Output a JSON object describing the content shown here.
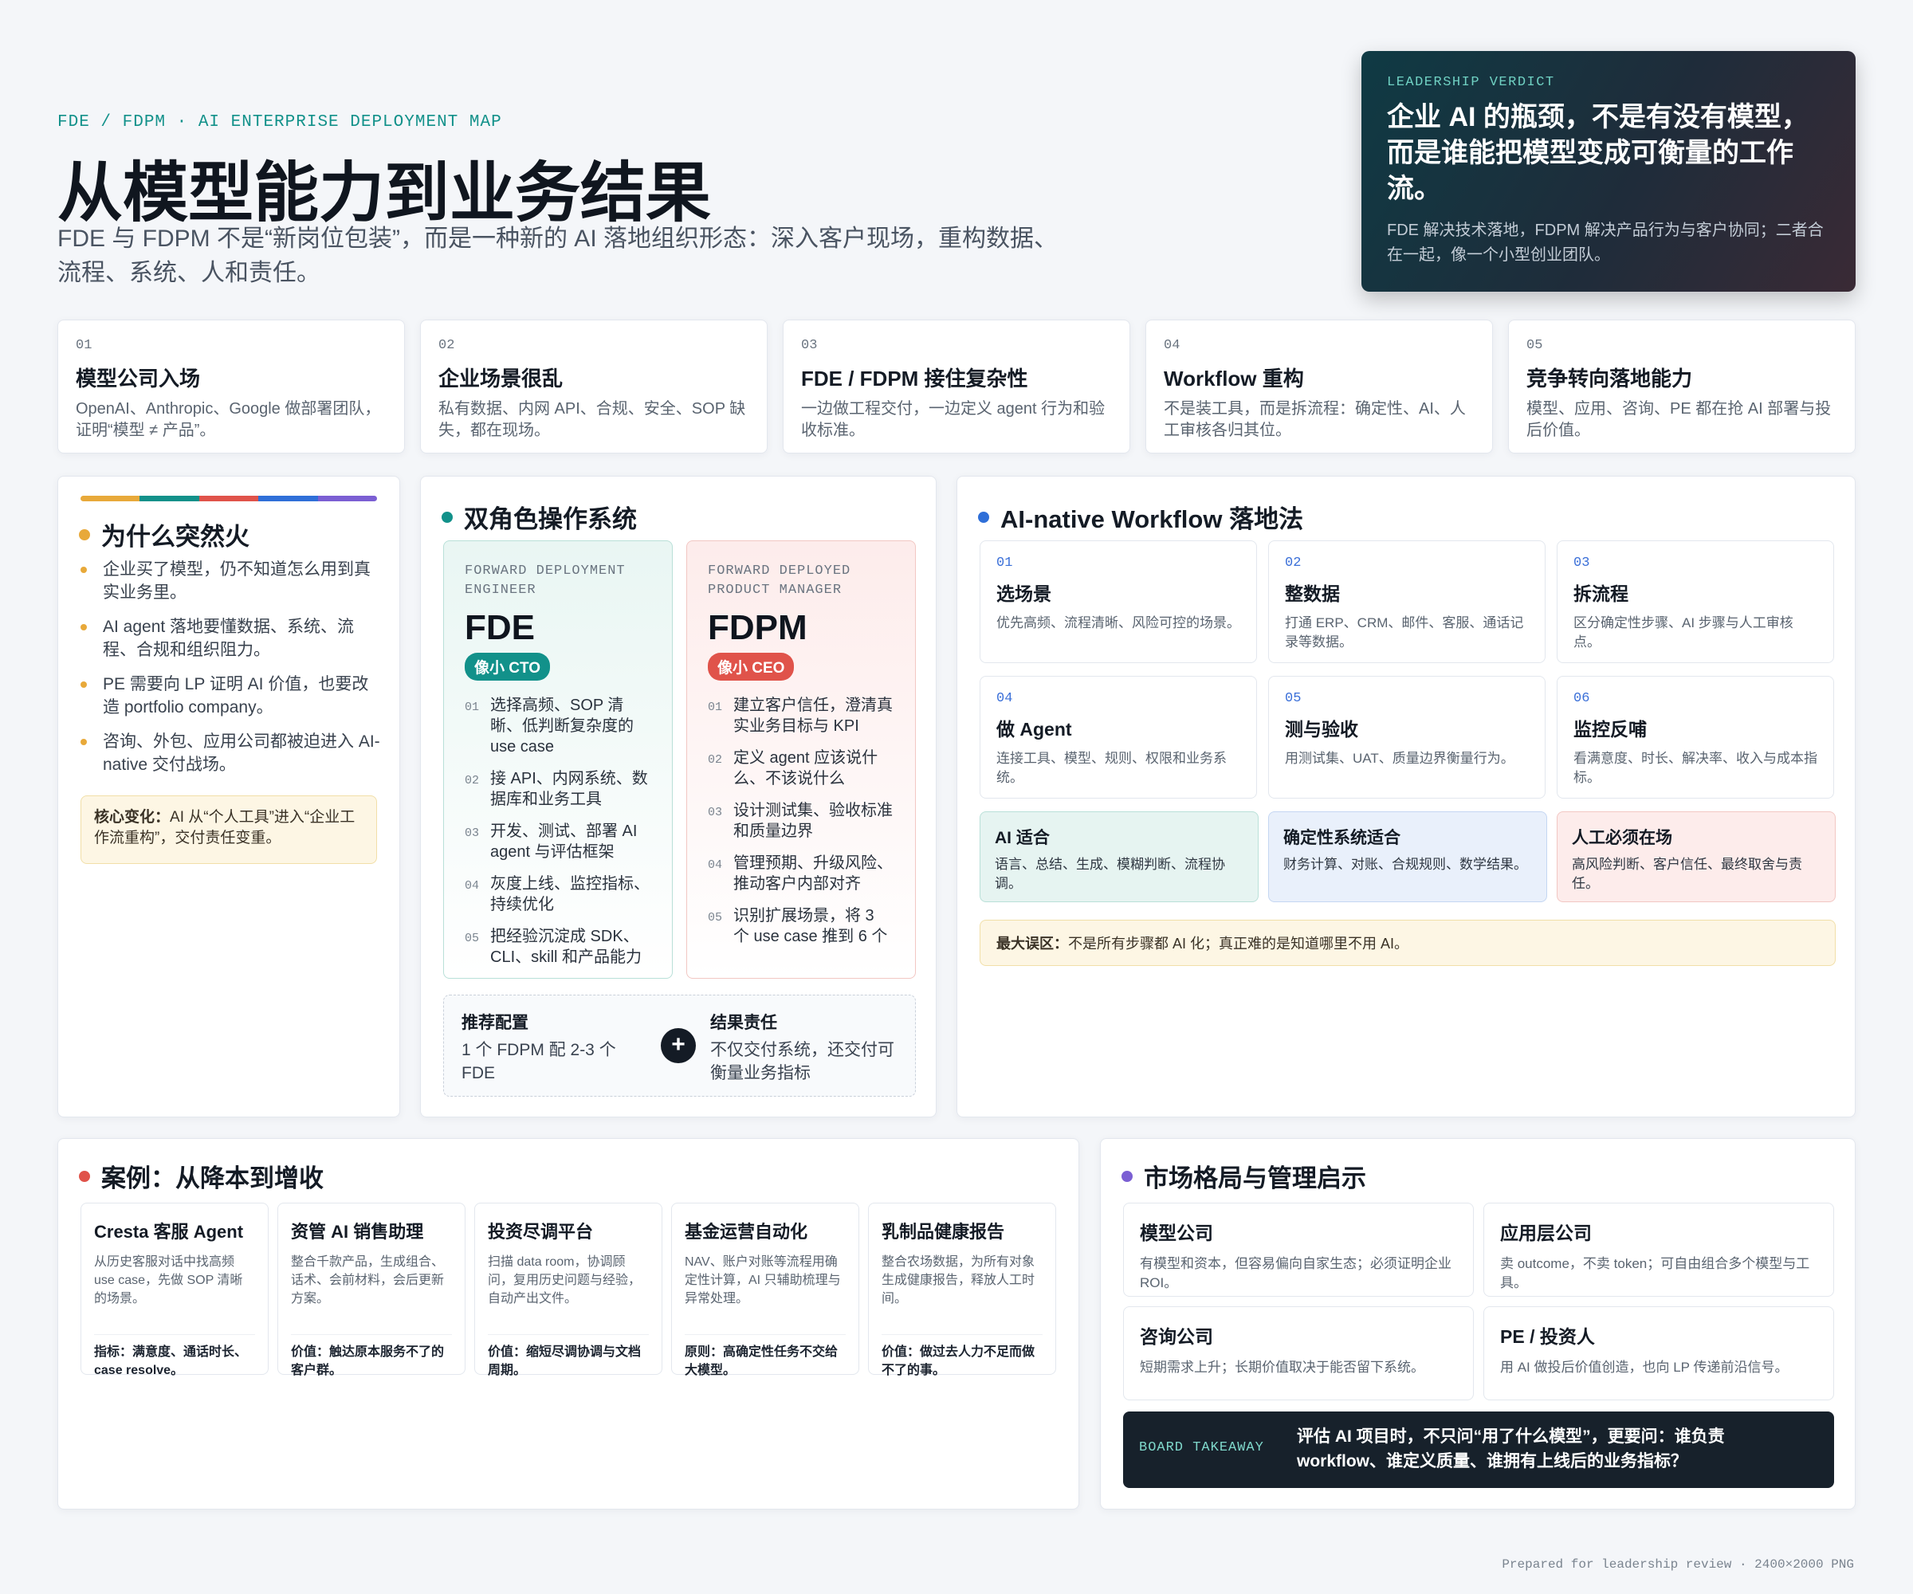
{
  "header": {
    "kicker": "FDE / FDPM · AI ENTERPRISE DEPLOYMENT MAP",
    "title": "从模型能力到业务结果",
    "subtitle": "FDE 与 FDPM 不是“新岗位包装”，而是一种新的 AI 落地组织形态：深入客户现场，重构数据、流程、系统、人和责任。"
  },
  "verdict": {
    "kicker": "LEADERSHIP VERDICT",
    "headline": "企业 AI 的瓶颈，不是有没有模型，而是谁能把模型变成可衡量的工作流。",
    "body": "FDE 解决技术落地，FDPM 解决产品行为与客户协同；二者合在一起，像一个小型创业团队。"
  },
  "steps": [
    {
      "num": "01",
      "title": "模型公司入场",
      "desc": "OpenAI、Anthropic、Google 做部署团队，证明“模型 ≠ 产品”。"
    },
    {
      "num": "02",
      "title": "企业场景很乱",
      "desc": "私有数据、内网 API、合规、安全、SOP 缺失，都在现场。"
    },
    {
      "num": "03",
      "title": "FDE / FDPM 接住复杂性",
      "desc": "一边做工程交付，一边定义 agent 行为和验收标准。"
    },
    {
      "num": "04",
      "title": "Workflow 重构",
      "desc": "不是装工具，而是拆流程：确定性、AI、人工审核各归其位。"
    },
    {
      "num": "05",
      "title": "竞争转向落地能力",
      "desc": "模型、应用、咨询、PE 都在抢 AI 部署与投后价值。"
    }
  ],
  "why": {
    "title": "为什么突然火",
    "items": [
      "企业买了模型，仍不知道怎么用到真实业务里。",
      "AI agent 落地要懂数据、系统、流程、合规和组织阻力。",
      "PE 需要向 LP 证明 AI 价值，也要改造 portfolio company。",
      "咨询、外包、应用公司都被迫进入 AI-native 交付战场。"
    ],
    "note_label": "核心变化：",
    "note_text": "AI 从“个人工具”进入“企业工作流重构”，交付责任变重。"
  },
  "dual": {
    "title": "双角色操作系统",
    "fde": {
      "kicker": "FORWARD DEPLOYMENT ENGINEER",
      "name": "FDE",
      "badge": "像小 CTO",
      "items": [
        {
          "n": "01",
          "t": "选择高频、SOP 清晰、低判断复杂度的 use case"
        },
        {
          "n": "02",
          "t": "接 API、内网系统、数据库和业务工具"
        },
        {
          "n": "03",
          "t": "开发、测试、部署 AI agent 与评估框架"
        },
        {
          "n": "04",
          "t": "灰度上线、监控指标、持续优化"
        },
        {
          "n": "05",
          "t": "把经验沉淀成 SDK、CLI、skill 和产品能力"
        }
      ]
    },
    "fdpm": {
      "kicker": "FORWARD DEPLOYED PRODUCT MANAGER",
      "name": "FDPM",
      "badge": "像小 CEO",
      "items": [
        {
          "n": "01",
          "t": "建立客户信任，澄清真实业务目标与 KPI"
        },
        {
          "n": "02",
          "t": "定义 agent 应该说什么、不该说什么"
        },
        {
          "n": "03",
          "t": "设计测试集、验收标准和质量边界"
        },
        {
          "n": "04",
          "t": "管理预期、升级风险、推动客户内部对齐"
        },
        {
          "n": "05",
          "t": "识别扩展场景，将 3 个 use case 推到 6 个"
        }
      ]
    },
    "config_title": "推荐配置",
    "config_text": "1 个 FDPM 配 2-3 个 FDE",
    "plus": "+",
    "result_title": "结果责任",
    "result_text": "不仅交付系统，还交付可衡量业务指标"
  },
  "workflow": {
    "title": "AI-native Workflow 落地法",
    "steps": [
      {
        "num": "01",
        "title": "选场景",
        "desc": "优先高频、流程清晰、风险可控的场景。"
      },
      {
        "num": "02",
        "title": "整数据",
        "desc": "打通 ERP、CRM、邮件、客服、通话记录等数据。"
      },
      {
        "num": "03",
        "title": "拆流程",
        "desc": "区分确定性步骤、AI 步骤与人工审核点。"
      },
      {
        "num": "04",
        "title": "做 Agent",
        "desc": "连接工具、模型、规则、权限和业务系统。"
      },
      {
        "num": "05",
        "title": "测与验收",
        "desc": "用测试集、UAT、质量边界衡量行为。"
      },
      {
        "num": "06",
        "title": "监控反哺",
        "desc": "看满意度、时长、解决率、收入与成本指标。"
      }
    ],
    "fits": [
      {
        "title": "AI 适合",
        "desc": "语言、总结、生成、模糊判断、流程协调。"
      },
      {
        "title": "确定性系统适合",
        "desc": "财务计算、对账、合规规则、数学结果。"
      },
      {
        "title": "人工必须在场",
        "desc": "高风险判断、客户信任、最终取舍与责任。"
      }
    ],
    "warn_label": "最大误区：",
    "warn_text": "不是所有步骤都 AI 化；真正难的是知道哪里不用 AI。"
  },
  "cases": {
    "title": "案例：从降本到增收",
    "items": [
      {
        "title": "Cresta 客服 Agent",
        "desc": "从历史客服对话中找高频 use case，先做 SOP 清晰的场景。",
        "metric": "指标：满意度、通话时长、case resolve。"
      },
      {
        "title": "资管 AI 销售助理",
        "desc": "整合千款产品，生成组合、话术、会前材料，会后更新方案。",
        "metric": "价值：触达原本服务不了的客户群。"
      },
      {
        "title": "投资尽调平台",
        "desc": "扫描 data room，协调顾问，复用历史问题与经验，自动产出文件。",
        "metric": "价值：缩短尽调协调与文档周期。"
      },
      {
        "title": "基金运营自动化",
        "desc": "NAV、账户对账等流程用确定性计算，AI 只辅助梳理与异常处理。",
        "metric": "原则：高确定性任务不交给大模型。"
      },
      {
        "title": "乳制品健康报告",
        "desc": "整合农场数据，为所有对象生成健康报告，释放人工时间。",
        "metric": "价值：做过去人力不足而做不了的事。"
      }
    ]
  },
  "market": {
    "title": "市场格局与管理启示",
    "items": [
      {
        "title": "模型公司",
        "desc": "有模型和资本，但容易偏向自家生态；必须证明企业 ROI。"
      },
      {
        "title": "应用层公司",
        "desc": "卖 outcome，不卖 token；可自由组合多个模型与工具。"
      },
      {
        "title": "咨询公司",
        "desc": "短期需求上升；长期价值取决于能否留下系统。"
      },
      {
        "title": "PE / 投资人",
        "desc": "用 AI 做投后价值创造，也向 LP 传递前沿信号。"
      }
    ],
    "board_label": "BOARD TAKEAWAY",
    "board_text": "评估 AI 项目时，不只问“用了什么模型”，更要问：谁负责 workflow、谁定义质量、谁拥有上线后的业务指标？"
  },
  "footer": "Prepared for leadership review · 2400×2000 PNG",
  "colors": {
    "teal": "#12918a",
    "blue": "#2f6fd8",
    "red": "#e0534a",
    "orange": "#e8a93a",
    "purple": "#7b5fd3"
  }
}
